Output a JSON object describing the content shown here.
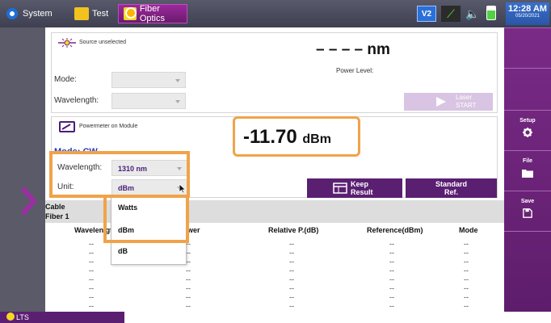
{
  "topbar": {
    "tabs": [
      {
        "label": "System",
        "icon": "gear-icon"
      },
      {
        "label": "Test",
        "icon": "test-icon"
      },
      {
        "label": "Fiber Optics",
        "icon": "fiber-optics-icon"
      }
    ],
    "status": {
      "v2_label": "V2"
    },
    "clock": {
      "time": "12:28 AM",
      "date": "05/20/2021"
    }
  },
  "source_section": {
    "title": "Source unselected",
    "wavelength_readout": "– – – – nm",
    "mode_label": "Mode:",
    "wavelength_label": "Wavelength:",
    "power_level_label": "Power Level:",
    "laser_button": {
      "line1": "Laser",
      "line2": "START"
    }
  },
  "powermeter_section": {
    "title": "Powermeter on Module",
    "mode_text": "Mode: CW",
    "wavelength_label": "Wavelength:",
    "wavelength_value": "1310 nm",
    "unit_label": "Unit:",
    "unit_value": "dBm",
    "power_value": "-11.70",
    "power_unit": "dBm",
    "keep_result": {
      "line1": "Keep",
      "line2": "Result"
    },
    "standard_ref": {
      "line1": "Standard",
      "line2": "Ref."
    }
  },
  "unit_dropdown": {
    "options": [
      "Watts",
      "dBm",
      "dB"
    ]
  },
  "table": {
    "cable_label": "Cable",
    "fiber_label": "Fiber 1",
    "headers": [
      "Wavelength",
      "Power",
      "Relative P.(dB)",
      "Reference(dBm)",
      "Mode"
    ],
    "header_partials": {
      "wavelength": "Wavelen gt",
      "power": "wer"
    },
    "rows": [
      [
        "--",
        "--",
        "--",
        "--",
        "--"
      ],
      [
        "--",
        "--",
        "--",
        "--",
        "--"
      ],
      [
        "--",
        "--",
        "--",
        "--",
        "--"
      ],
      [
        "--",
        "--",
        "--",
        "--",
        "--"
      ],
      [
        "--",
        "--",
        "--",
        "--",
        "--"
      ],
      [
        "--",
        "--",
        "--",
        "--",
        "--"
      ],
      [
        "--",
        "--",
        "--",
        "--",
        "--"
      ],
      [
        "--",
        "--",
        "--",
        "--",
        "--"
      ]
    ]
  },
  "sidebar": {
    "buttons": [
      {
        "label": "",
        "icon": ""
      },
      {
        "label": "",
        "icon": ""
      },
      {
        "label": "Setup",
        "icon": "gear-icon"
      },
      {
        "label": "File",
        "icon": "folder-icon"
      },
      {
        "label": "Save",
        "icon": "save-icon"
      },
      {
        "label": "",
        "icon": ""
      }
    ]
  },
  "bottom": {
    "lts_label": "LTS"
  },
  "colors": {
    "accent": "#5b1f72",
    "highlight": "#f0a34a",
    "mode_value": "#1a3fd0"
  }
}
